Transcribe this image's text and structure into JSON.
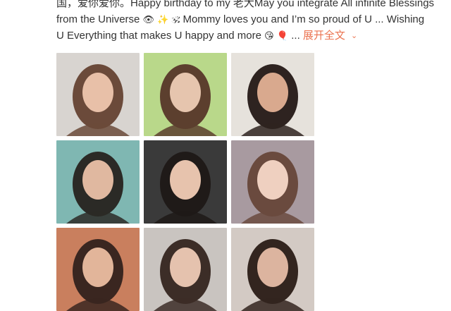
{
  "post": {
    "line1": "国，爱你爱你。Happy birthday to my 老大May you integrate All infinite Blessings",
    "line2_text": "from the Universe",
    "line2_emojis": [
      "👁",
      "✨",
      "🕉"
    ],
    "line2_rest": " Mommy loves you and I’m so proud of U ... Wishing",
    "line3_text": "U Everything that makes U happy and more",
    "line3_emojis": [
      "😘",
      "🎈"
    ],
    "line3_ellipsis": " ... ",
    "expand_label": "展开全文",
    "expand_icon": "chevron-down"
  },
  "photos": [
    {
      "name": "photo-1",
      "bg": "#d8d4d0",
      "accent": "#6b4a3a",
      "skin": "#e8c0a8"
    },
    {
      "name": "photo-2",
      "bg": "#b9d88a",
      "accent": "#5c3f2e",
      "skin": "#e6c5ae"
    },
    {
      "name": "photo-3",
      "bg": "#e6e2dc",
      "accent": "#2e2320",
      "skin": "#d9a98e"
    },
    {
      "name": "photo-4",
      "bg": "#7fb7b2",
      "accent": "#2b2a26",
      "skin": "#e0b8a0"
    },
    {
      "name": "photo-5",
      "bg": "#3a3a3a",
      "accent": "#1f1a18",
      "skin": "#e7c3ad"
    },
    {
      "name": "photo-6",
      "bg": "#a89aa0",
      "accent": "#6a4a3e",
      "skin": "#efd0c0"
    },
    {
      "name": "photo-7",
      "bg": "#c97f5e",
      "accent": "#3a2620",
      "skin": "#e2b59a"
    },
    {
      "name": "photo-8",
      "bg": "#c9c4c0",
      "accent": "#3c2d27",
      "skin": "#e5c2ae"
    },
    {
      "name": "photo-9",
      "bg": "#d3cac4",
      "accent": "#33251f",
      "skin": "#dcb49f"
    }
  ]
}
